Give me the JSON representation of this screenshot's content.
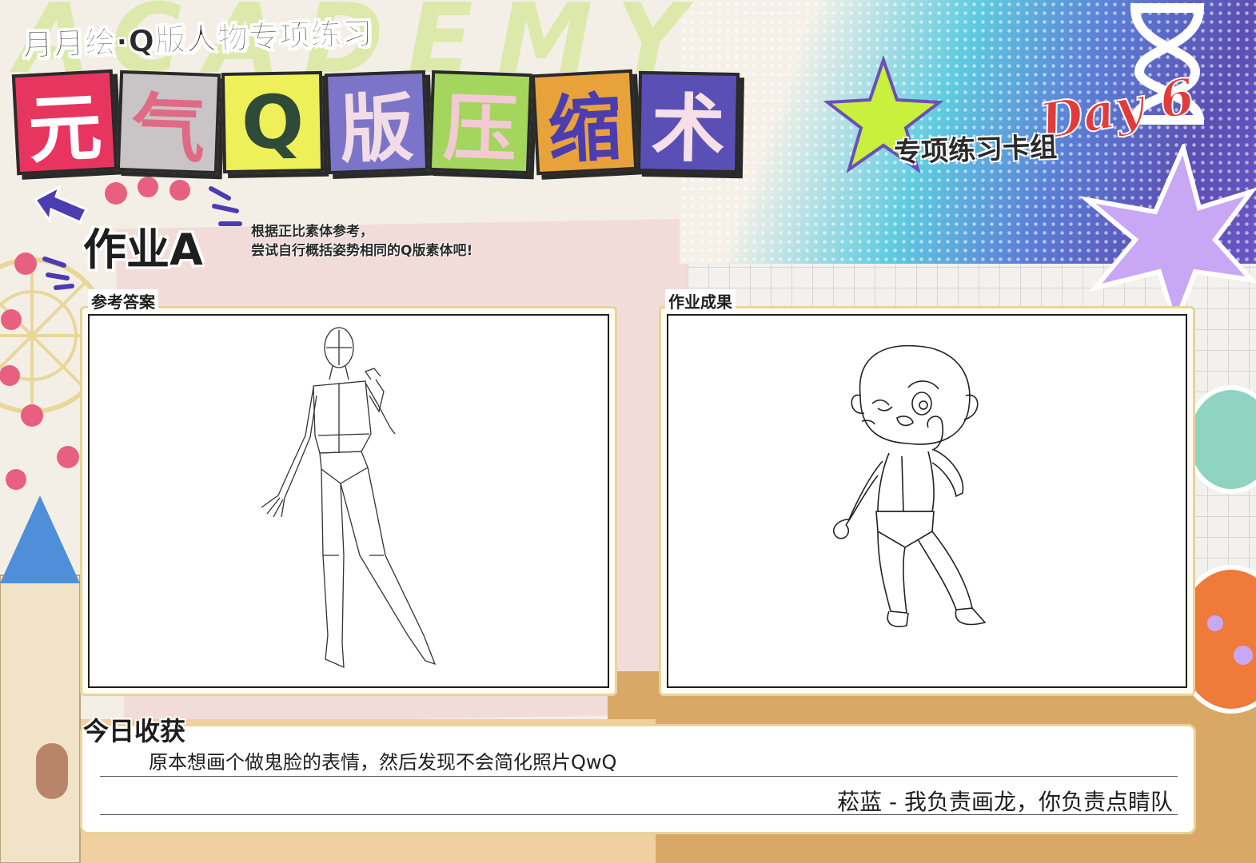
{
  "header": {
    "course_title": "月月绘·Q版人物专项练习",
    "title_chars": [
      {
        "char": "元",
        "bg": "#e8355f",
        "color": "#ffffff"
      },
      {
        "char": "气",
        "bg": "#c9c4c6",
        "color": "#e06a86"
      },
      {
        "char": "Q",
        "bg": "#eef05a",
        "color": "#2f4a38"
      },
      {
        "char": "版",
        "bg": "#7b74c9",
        "color": "#f2dde6"
      },
      {
        "char": "压",
        "bg": "#a4d65e",
        "color": "#f3c9d3"
      },
      {
        "char": "缩",
        "bg": "#e8a23a",
        "color": "#4b3cb0"
      },
      {
        "char": "术",
        "bg": "#5a4fb5",
        "color": "#f7dfe8"
      }
    ],
    "deck_label": "专项练习卡组",
    "day_label": "Day 6",
    "background_word": "ACADEMY"
  },
  "assignment": {
    "title": "作业A",
    "instruction_line1": "根据正比素体参考，",
    "instruction_line2": "尝试自行概括姿势相同的Q版素体吧!"
  },
  "panels": {
    "reference_label": "参考答案",
    "result_label": "作业成果"
  },
  "notes": {
    "title": "今日收获",
    "text": "原本想画个做鬼脸的表情，然后发现不会简化照片QwQ",
    "signature": "菘蓝 - 我负责画龙，你负责点睛队"
  },
  "colors": {
    "accent_purple": "#5a4fb5",
    "accent_red": "#e23b3b",
    "accent_lime": "#c8f03c",
    "panel_border": "#e9d39a"
  }
}
